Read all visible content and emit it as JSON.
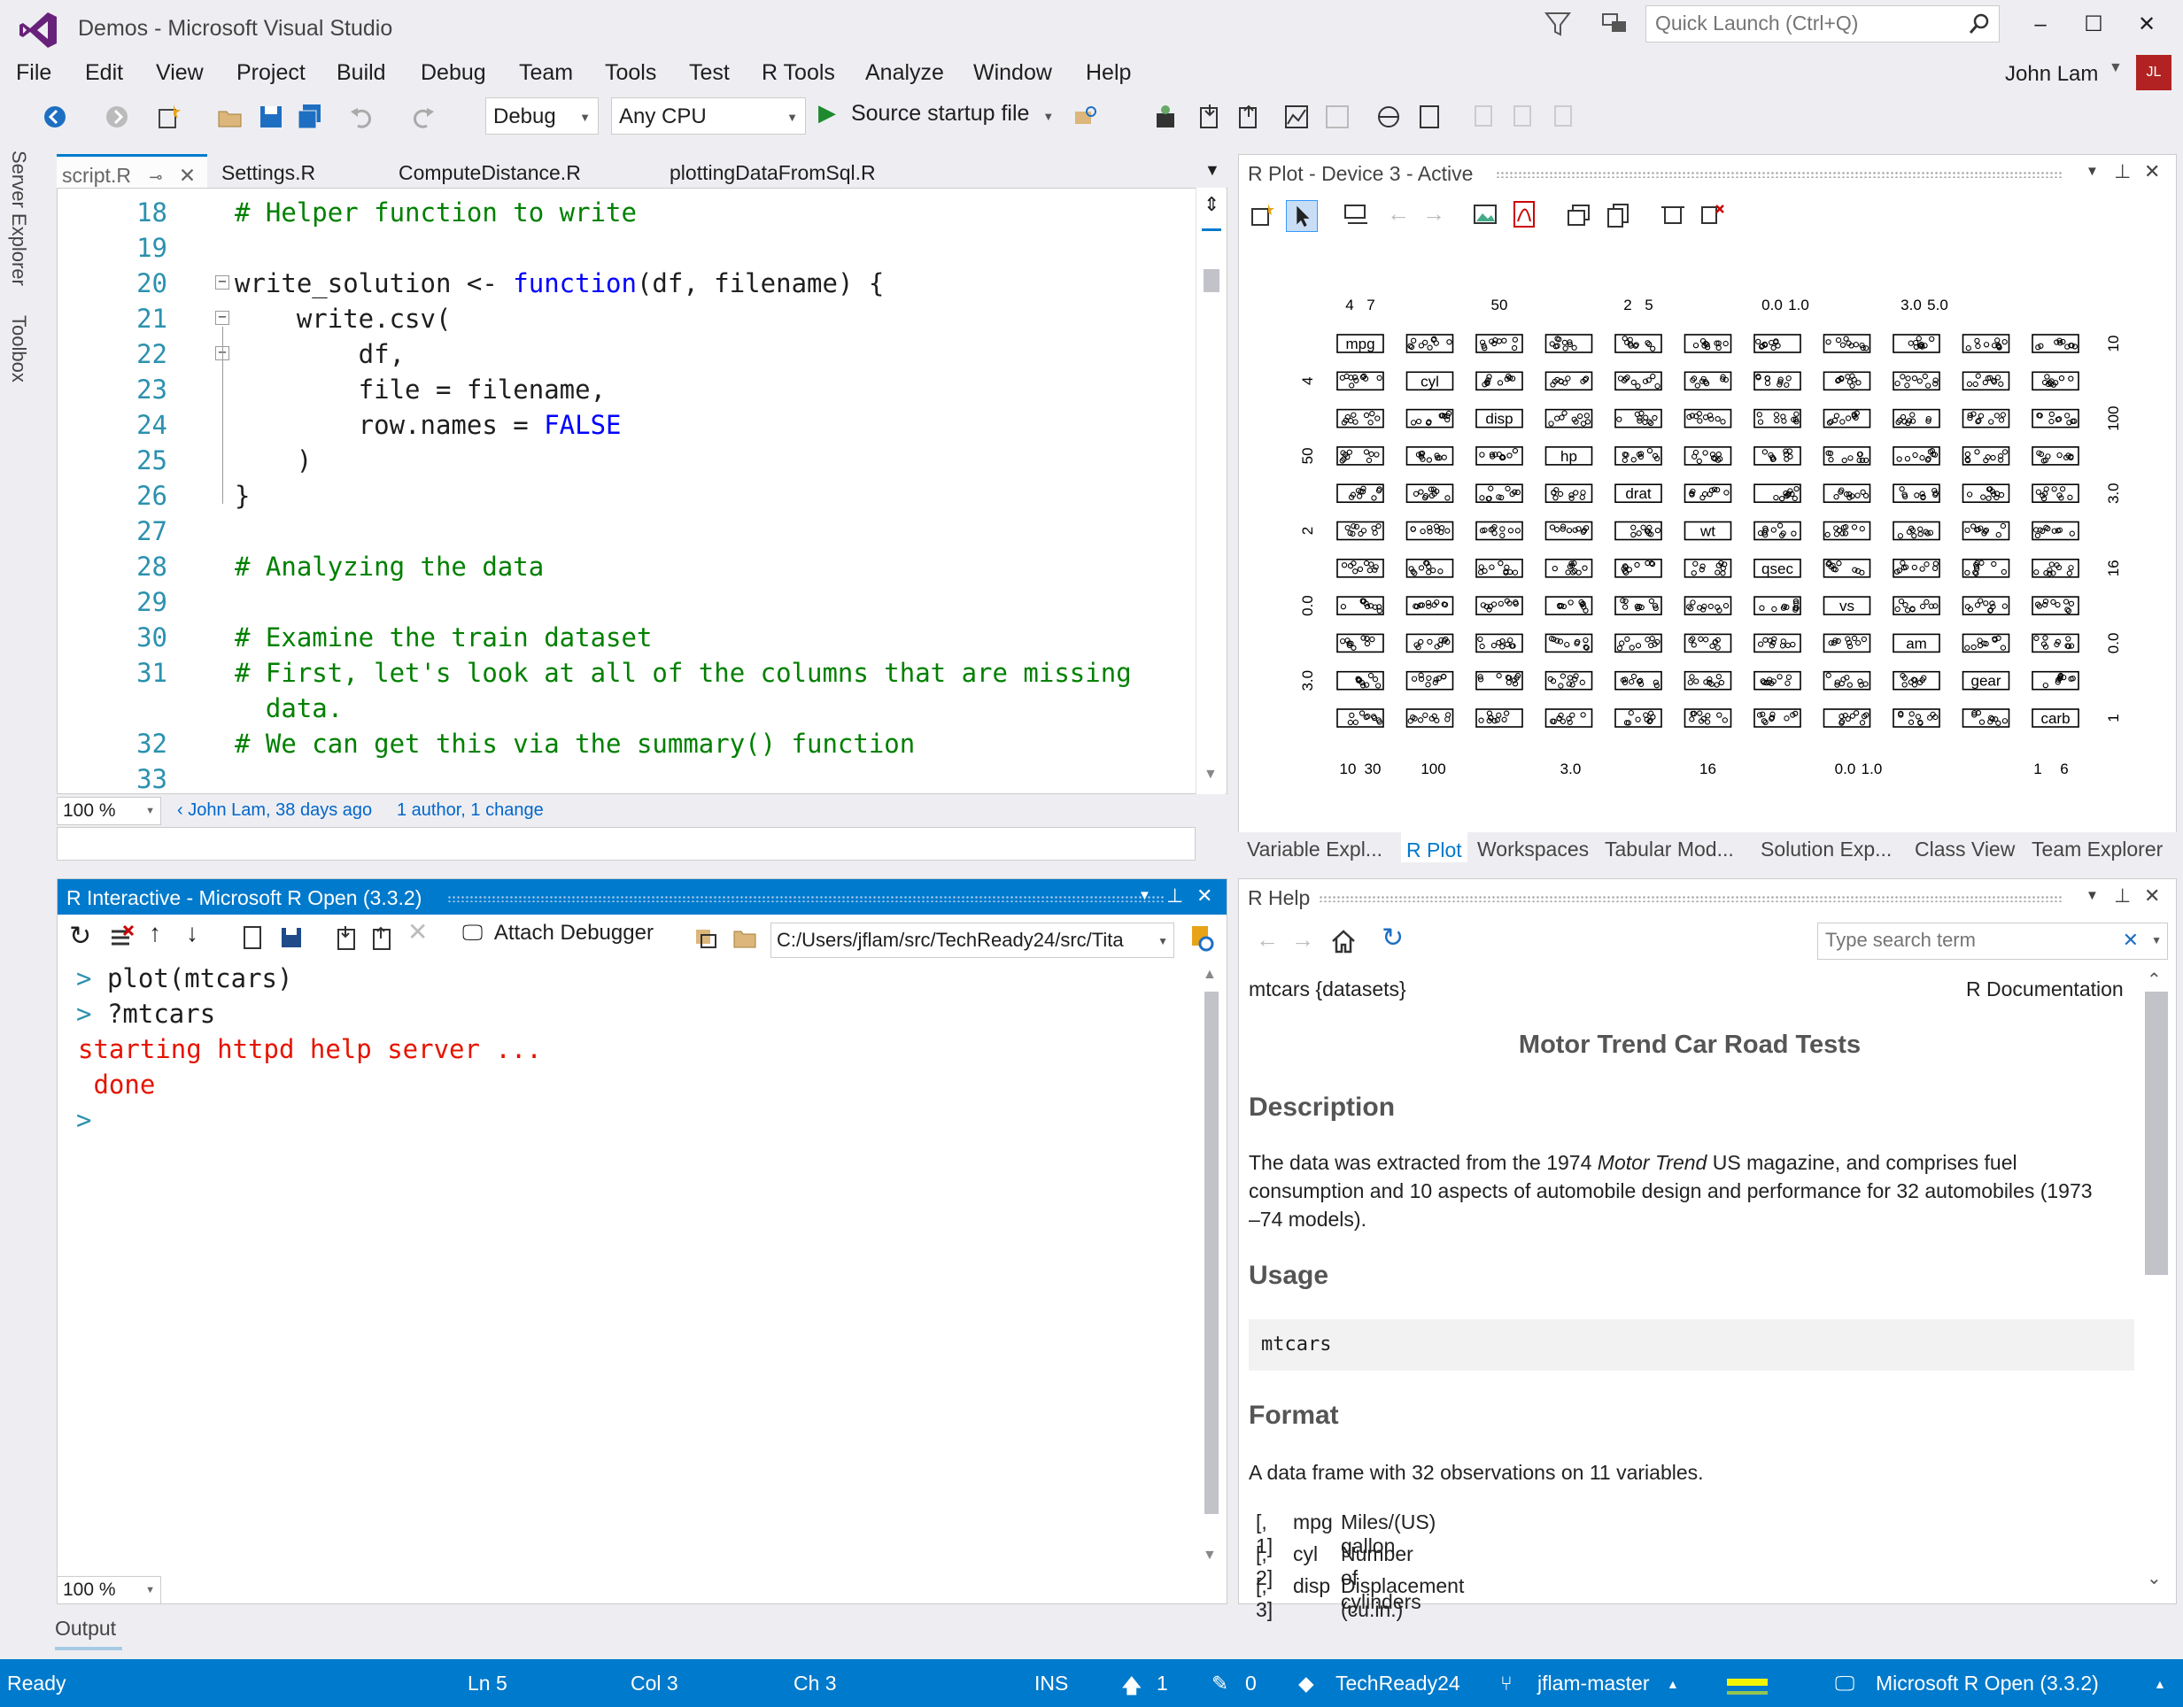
{
  "window": {
    "title": "Demos - Microsoft Visual Studio",
    "quick_launch_placeholder": "Quick Launch (Ctrl+Q)",
    "controls": [
      "–",
      "☐",
      "✕"
    ]
  },
  "menu": [
    "File",
    "Edit",
    "View",
    "Project",
    "Build",
    "Debug",
    "Team",
    "Tools",
    "Test",
    "R Tools",
    "Analyze",
    "Window",
    "Help"
  ],
  "user": {
    "name": "John Lam",
    "initials": "JL"
  },
  "toolbar": {
    "config": "Debug",
    "platform": "Any CPU",
    "start_label": "Source startup file"
  },
  "side_tabs": [
    "Server Explorer",
    "Toolbox"
  ],
  "editor": {
    "tabs": [
      "script.R",
      "Settings.R",
      "ComputeDistance.R",
      "plottingDataFromSql.R"
    ],
    "lines": [
      {
        "n": "18",
        "text": "# Helper function to write",
        "kind": "cmt"
      },
      {
        "n": "19",
        "text": "",
        "kind": "plain"
      },
      {
        "n": "20",
        "pre": "write_solution <- ",
        "kw": "function",
        "post": "(df, filename) {",
        "kind": "mixed"
      },
      {
        "n": "21",
        "text": "    write.csv(",
        "kind": "plain"
      },
      {
        "n": "22",
        "text": "        df,",
        "kind": "plain"
      },
      {
        "n": "23",
        "text": "        file = filename,",
        "kind": "plain"
      },
      {
        "n": "24",
        "pre": "        row.names = ",
        "kw": "FALSE",
        "post": "",
        "kind": "mixed"
      },
      {
        "n": "25",
        "text": "    )",
        "kind": "plain"
      },
      {
        "n": "26",
        "text": "}",
        "kind": "plain"
      },
      {
        "n": "27",
        "text": "",
        "kind": "plain"
      },
      {
        "n": "28",
        "text": "# Analyzing the data",
        "kind": "cmt"
      },
      {
        "n": "29",
        "text": "",
        "kind": "plain"
      },
      {
        "n": "30",
        "text": "# Examine the train dataset",
        "kind": "cmt"
      },
      {
        "n": "31",
        "text": "# First, let's look at all of the columns that are missing",
        "kind": "cmt"
      },
      {
        "n": "",
        "text": "  data.",
        "kind": "cmt"
      },
      {
        "n": "32",
        "text": "# We can get this via the summary() function",
        "kind": "cmt"
      },
      {
        "n": "33",
        "text": "",
        "kind": "plain"
      }
    ],
    "zoom": "100 %",
    "blame_author": "‹ John Lam, 38 days ago",
    "blame_changes": "1 author, 1 change"
  },
  "plot": {
    "title": "R Plot - Device 3 - Active",
    "bottom_tabs": [
      "Variable Expl...",
      "R Plot",
      "Workspaces",
      "Tabular Mod...",
      "Solution Exp...",
      "Class View",
      "Team Explorer"
    ]
  },
  "chart_data": {
    "type": "scatter",
    "title": "",
    "variables": [
      "mpg",
      "cyl",
      "disp",
      "hp",
      "drat",
      "wt",
      "qsec",
      "vs",
      "am",
      "gear",
      "carb"
    ],
    "top_axis_labels": [
      "4",
      "7",
      "50",
      "2",
      "5",
      "0.0",
      "1.0",
      "3.0",
      "5.0"
    ],
    "bottom_axis_labels": [
      "10",
      "30",
      "100",
      "3.0",
      "16",
      "0.0",
      "1.0",
      "1",
      "6"
    ],
    "left_axis_labels": [
      "4",
      "50",
      "2",
      "0.0",
      "3.0"
    ],
    "right_axis_labels": [
      "10",
      "100",
      "3.0",
      "16",
      "0.0",
      "1"
    ]
  },
  "interactive": {
    "title": "R Interactive - Microsoft R Open (3.3.2)",
    "attach_label": "Attach Debugger",
    "working_dir": "C:/Users/jflam/src/TechReady24/src/Tita",
    "lines": [
      {
        "prompt": ">",
        "text": "plot(mtcars)",
        "kind": "input"
      },
      {
        "prompt": ">",
        "text": "?mtcars",
        "kind": "input"
      },
      {
        "prompt": "",
        "text": "starting httpd help server ...",
        "kind": "msg"
      },
      {
        "prompt": "",
        "text": " done",
        "kind": "msg"
      },
      {
        "prompt": ">",
        "text": "",
        "kind": "input"
      }
    ],
    "zoom": "100 %"
  },
  "help": {
    "title": "R Help",
    "search_placeholder": "Type search term",
    "dataset": "mtcars {datasets}",
    "doc_label": "R Documentation",
    "heading": "Motor Trend Car Road Tests",
    "description_h": "Description",
    "description_1": "The data was extracted from the 1974 ",
    "description_em": "Motor Trend",
    "description_2": " US magazine, and comprises fuel",
    "description_line2": "consumption and 10 aspects of automobile design and performance for 32 automobiles (1973",
    "description_line3": "–74 models).",
    "usage_h": "Usage",
    "usage_code": "mtcars",
    "format_h": "Format",
    "format_text": "A data frame with 32 observations on 11 variables.",
    "format_rows": [
      {
        "idx": "[, 1]",
        "var": "mpg",
        "desc": "Miles/(US) gallon"
      },
      {
        "idx": "[, 2]",
        "var": "cyl",
        "desc": "Number of cylinders"
      },
      {
        "idx": "[, 3]",
        "var": "disp",
        "desc": "Displacement (cu.in.)"
      }
    ]
  },
  "output_label": "Output",
  "status": {
    "ready": "Ready",
    "ln": "Ln 5",
    "col": "Col 3",
    "ch": "Ch 3",
    "ins": "INS",
    "push": "1",
    "edits": "0",
    "repo": "TechReady24",
    "branch": "jflam-master",
    "r_version": "Microsoft R Open (3.3.2)"
  },
  "colors": {
    "accent": "#007acc",
    "comment": "#008000",
    "keyword": "#0000ff",
    "line_number": "#2b91af",
    "error": "#e51400",
    "vs_purple": "#68217a"
  }
}
